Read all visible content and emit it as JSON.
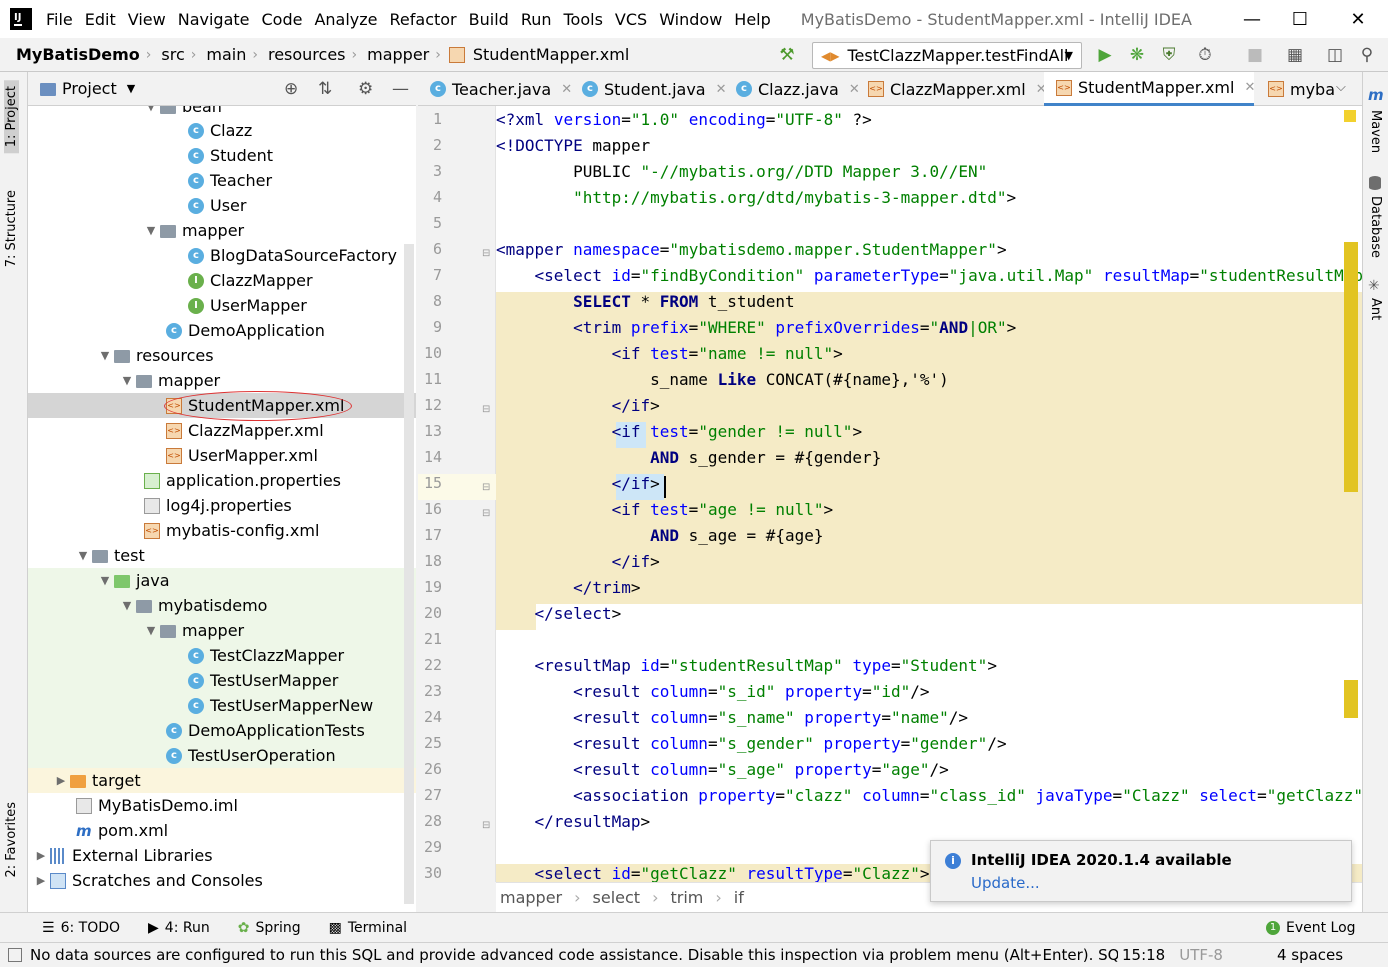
{
  "menubar": {
    "items": [
      "File",
      "Edit",
      "View",
      "Navigate",
      "Code",
      "Analyze",
      "Refactor",
      "Build",
      "Run",
      "Tools",
      "VCS",
      "Window",
      "Help"
    ],
    "window_title": "MyBatisDemo - StudentMapper.xml - IntelliJ IDEA"
  },
  "navbar": {
    "crumbs": [
      "MyBatisDemo",
      "src",
      "main",
      "resources",
      "mapper",
      "StudentMapper.xml"
    ],
    "run_config": "TestClazzMapper.testFindAll"
  },
  "left_strip": {
    "project": "1: Project",
    "structure": "7: Structure",
    "favorites": "2: Favorites"
  },
  "right_strip": {
    "maven": "Maven",
    "database": "Database",
    "ant": "Ant"
  },
  "project_panel": {
    "title": "Project",
    "nodes": [
      {
        "label": "bean",
        "icon": "folder"
      },
      {
        "label": "Clazz",
        "icon": "class-icon"
      },
      {
        "label": "Student",
        "icon": "class-icon"
      },
      {
        "label": "Teacher",
        "icon": "class-icon"
      },
      {
        "label": "User",
        "icon": "class-icon"
      },
      {
        "label": "mapper",
        "icon": "folder"
      },
      {
        "label": "BlogDataSourceFactory",
        "icon": "class-icon"
      },
      {
        "label": "ClazzMapper",
        "icon": "interface-icon"
      },
      {
        "label": "UserMapper",
        "icon": "interface-icon"
      },
      {
        "label": "DemoApplication",
        "icon": "spring-class-icon"
      },
      {
        "label": "resources",
        "icon": "folder"
      },
      {
        "label": "mapper",
        "icon": "folder"
      },
      {
        "label": "StudentMapper.xml",
        "icon": "xml-icon"
      },
      {
        "label": "ClazzMapper.xml",
        "icon": "xml-icon"
      },
      {
        "label": "UserMapper.xml",
        "icon": "xml-icon"
      },
      {
        "label": "application.properties",
        "icon": "properties-icon"
      },
      {
        "label": "log4j.properties",
        "icon": "properties-icon"
      },
      {
        "label": "mybatis-config.xml",
        "icon": "xml-icon"
      },
      {
        "label": "test",
        "icon": "folder"
      },
      {
        "label": "java",
        "icon": "test-folder"
      },
      {
        "label": "mybatisdemo",
        "icon": "folder"
      },
      {
        "label": "mapper",
        "icon": "folder"
      },
      {
        "label": "TestClazzMapper",
        "icon": "test-class-icon"
      },
      {
        "label": "TestUserMapper",
        "icon": "test-class-icon"
      },
      {
        "label": "TestUserMapperNew",
        "icon": "test-class-icon"
      },
      {
        "label": "DemoApplicationTests",
        "icon": "test-class-icon"
      },
      {
        "label": "TestUserOperation",
        "icon": "test-class-icon"
      },
      {
        "label": "target",
        "icon": "folder"
      },
      {
        "label": "MyBatisDemo.iml",
        "icon": "iml-icon"
      },
      {
        "label": "pom.xml",
        "icon": "maven-icon"
      },
      {
        "label": "External Libraries",
        "icon": "library-icon"
      },
      {
        "label": "Scratches and Consoles",
        "icon": "scratches-icon"
      }
    ]
  },
  "tabs": [
    "Teacher.java",
    "Student.java",
    "Clazz.java",
    "ClazzMapper.xml",
    "StudentMapper.xml",
    "myba"
  ],
  "line_numbers": [
    "1",
    "2",
    "3",
    "4",
    "5",
    "6",
    "7",
    "8",
    "9",
    "10",
    "11",
    "12",
    "13",
    "14",
    "15",
    "16",
    "17",
    "18",
    "19",
    "20",
    "21",
    "22",
    "23",
    "24",
    "25",
    "26",
    "27",
    "28",
    "29",
    "30"
  ],
  "code": [
    "<?xml version=\"1.0\" encoding=\"UTF-8\" ?>",
    "<!DOCTYPE mapper",
    "        PUBLIC \"-//mybatis.org//DTD Mapper 3.0//EN\"",
    "        \"http://mybatis.org/dtd/mybatis-3-mapper.dtd\">",
    "",
    "<mapper namespace=\"mybatisdemo.mapper.StudentMapper\">",
    "    <select id=\"findByCondition\" parameterType=\"java.util.Map\" resultMap=\"studentResultMap\">",
    "        SELECT * FROM t_student",
    "        <trim prefix=\"WHERE\" prefixOverrides=\"AND|OR\">",
    "            <if test=\"name != null\">",
    "                s_name Like CONCAT(#{name},'%')",
    "            </if>",
    "            <if test=\"gender != null\">",
    "                AND s_gender = #{gender}",
    "            </if>",
    "            <if test=\"age != null\">",
    "                AND s_age = #{age}",
    "            </if>",
    "        </trim>",
    "    </select>",
    "",
    "    <resultMap id=\"studentResultMap\" type=\"Student\">",
    "        <result column=\"s_id\" property=\"id\"/>",
    "        <result column=\"s_name\" property=\"name\"/>",
    "        <result column=\"s_gender\" property=\"gender\"/>",
    "        <result column=\"s_age\" property=\"age\"/>",
    "        <association property=\"clazz\" column=\"class_id\" javaType=\"Clazz\" select=\"getClazz\"/>",
    "    </resultMap>",
    "",
    "    <select id=\"getClazz\" resultType=\"Clazz\">"
  ],
  "editor_breadcrumb": [
    "mapper",
    "select",
    "trim",
    "if"
  ],
  "notification": {
    "title": "IntelliJ IDEA 2020.1.4 available",
    "link": "Update..."
  },
  "bottom_tabs": [
    "6: TODO",
    "4: Run",
    "Spring",
    "Terminal"
  ],
  "event_log": "Event Log",
  "status": {
    "message": "No data sources are configured to run this SQL and provide advanced code assistance. Disable this inspection via problem menu (Alt+Enter). SQL diale",
    "position": "15:18",
    "encoding": "UTF-8",
    "indent": "4 spaces"
  }
}
